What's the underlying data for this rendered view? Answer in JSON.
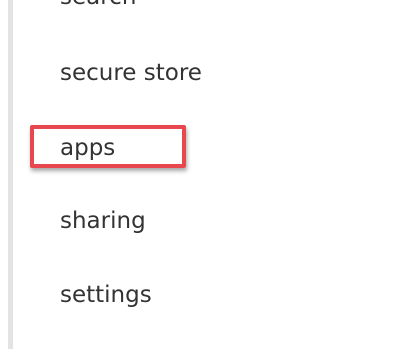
{
  "nav": {
    "items": [
      {
        "id": "search",
        "label": "search"
      },
      {
        "id": "secure-store",
        "label": "secure store"
      },
      {
        "id": "apps",
        "label": "apps"
      },
      {
        "id": "sharing",
        "label": "sharing"
      },
      {
        "id": "settings",
        "label": "settings"
      }
    ]
  },
  "highlight": {
    "target": "apps",
    "color": "#e8474e"
  },
  "colors": {
    "text": "#333333",
    "rule": "#e3e3e3",
    "background": "#ffffff"
  }
}
